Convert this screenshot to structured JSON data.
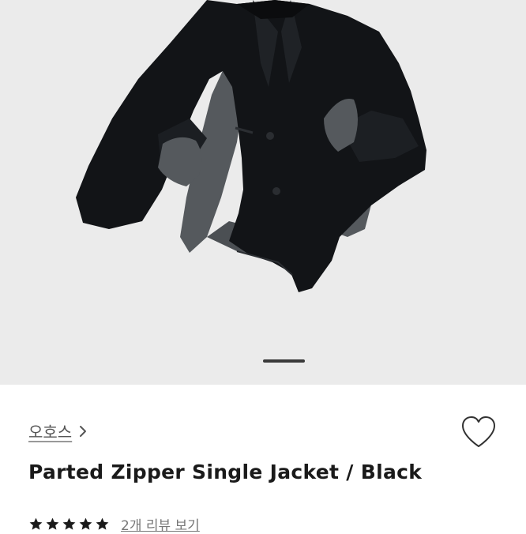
{
  "product": {
    "brand": "오호스",
    "title": "Parted Zipper Single Jacket / Black",
    "rating": 5,
    "rating_max": 5,
    "review_link": "2개 리뷰 보기"
  },
  "carousel": {
    "slide_count": 1,
    "active_slide": 1
  },
  "colors": {
    "hero_background": "#ebebeb",
    "jacket_body": "#121417",
    "jacket_panel": "#55595d",
    "indicator": "#3a3a3a",
    "title_text": "#1a1a1a",
    "brand_text": "#555555",
    "star": "#1a1a1a"
  },
  "icons": {
    "brand_chevron": "chevron-right-icon",
    "wishlist": "heart-outline-icon",
    "rating": "star-icon"
  }
}
